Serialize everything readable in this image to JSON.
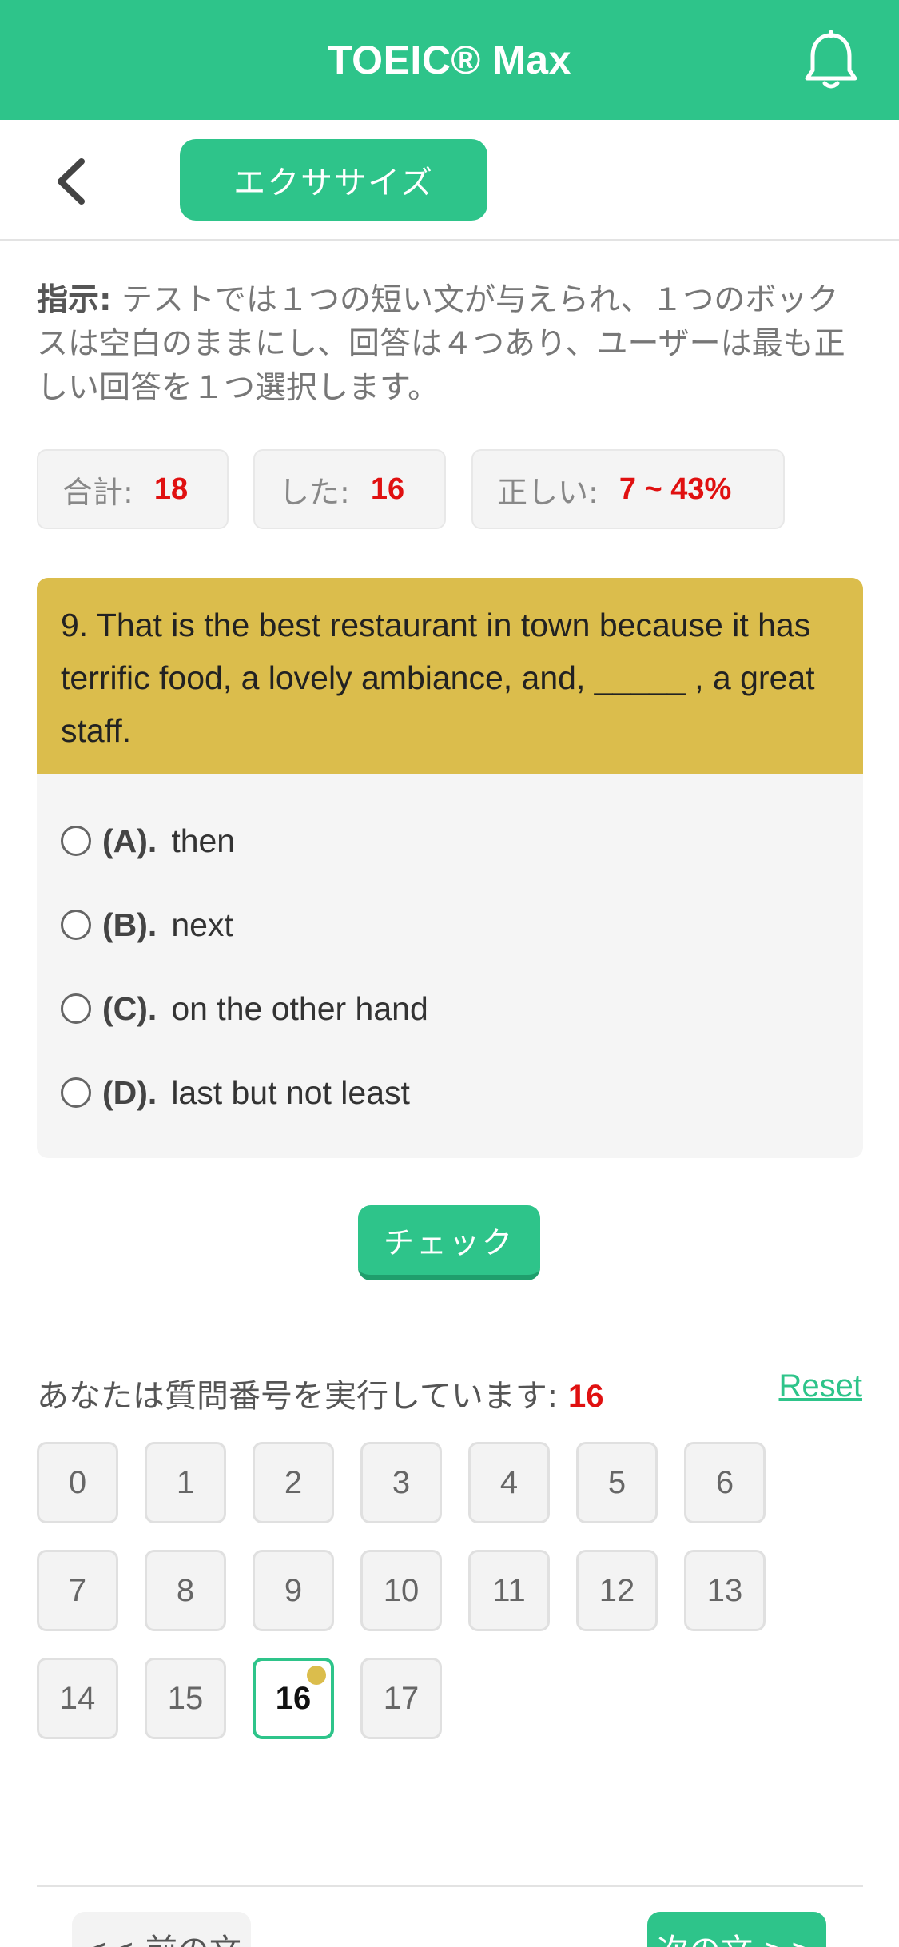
{
  "header": {
    "title": "TOEIC® Max",
    "bell_icon": "bell-icon"
  },
  "subbar": {
    "back_icon": "chevron-left-icon",
    "tab_label": "エクササイズ"
  },
  "instructions": {
    "label": "指示:",
    "text": " テストでは１つの短い文が与えられ、１つのボックスは空白のままにし、回答は４つあり、ユーザーは最も正しい回答を１つ選択します。"
  },
  "stats": {
    "total_label": "合計:",
    "total_value": "18",
    "done_label": "した:",
    "done_value": "16",
    "correct_label": "正しい:",
    "correct_value": "7 ~ 43%"
  },
  "question": {
    "text": "9. That is the best restaurant in town because it has terrific food, a lovely ambiance, and, _____ , a great staff.",
    "options": [
      {
        "letter": "(A).",
        "text": "then"
      },
      {
        "letter": "(B).",
        "text": "next"
      },
      {
        "letter": "(C).",
        "text": "on the other hand"
      },
      {
        "letter": "(D).",
        "text": "last but not least"
      }
    ]
  },
  "check_button": "チェック",
  "progress": {
    "running_label": "あなたは質問番号を実行しています: ",
    "current": "16",
    "reset_label": "Reset"
  },
  "grid": [
    "0",
    "1",
    "2",
    "3",
    "4",
    "5",
    "6",
    "7",
    "8",
    "9",
    "10",
    "11",
    "12",
    "13",
    "14",
    "15",
    "16",
    "17"
  ],
  "footer": {
    "prev_label": "<< 前の文",
    "next_label": "次の文 >>"
  },
  "colors": {
    "accent": "#2ec48a",
    "question_bg": "#dbbd4c",
    "highlight": "#e01010"
  }
}
